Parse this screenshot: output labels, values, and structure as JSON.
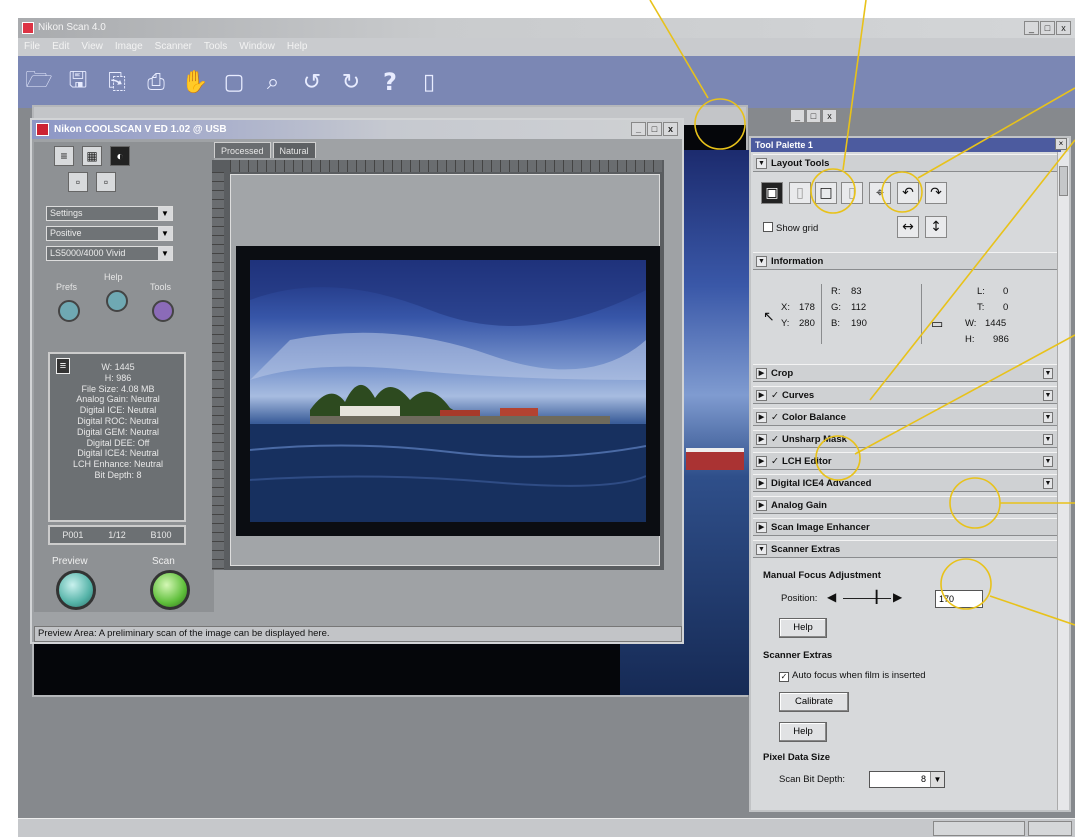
{
  "app": {
    "title": "Nikon Scan 4.0",
    "menu": [
      "File",
      "Edit",
      "View",
      "Image",
      "Scanner",
      "Tools",
      "Window",
      "Help"
    ],
    "window_buttons": [
      "_",
      "□",
      "x"
    ]
  },
  "toolbar": {
    "icons": [
      "open-folder-icon",
      "save-icon",
      "copy-icon",
      "print-icon",
      "hand-icon",
      "crop-icon",
      "zoom-icon",
      "rotate-left-icon",
      "rotate-right-icon",
      "help-icon",
      "info-icon"
    ],
    "help_glyph": "?"
  },
  "scanner_dialog": {
    "title": "Nikon COOLSCAN V ED 1.02 @ USB",
    "window_buttons": [
      "_",
      "□",
      "x"
    ],
    "dropdowns": [
      "Settings",
      "Positive",
      "LS5000/4000 Vivid"
    ],
    "round_buttons": {
      "prefs": "Prefs",
      "help": "Help",
      "tools": "Tools"
    },
    "info_lines": [
      "W: 1445",
      "H: 986",
      "File Size: 4.08 MB",
      "Analog Gain: Neutral",
      "Digital ICE: Neutral",
      "Digital ROC: Neutral",
      "Digital GEM: Neutral",
      "Digital DEE: Off",
      "Digital ICE4: Neutral",
      "LCH Enhance: Neutral",
      "Bit Depth: 8"
    ],
    "info_bar": [
      "P001",
      "1/12",
      "B100"
    ],
    "preview_label": "Preview",
    "scan_label": "Scan",
    "tabs": [
      "Processed",
      "Natural"
    ],
    "status_text": "Preview Area: A preliminary scan of the image can be displayed here."
  },
  "tool_palette": {
    "title": "Tool Palette 1",
    "layout_tools": {
      "header": "Layout Tools",
      "show_grid": "Show grid"
    },
    "information": {
      "header": "Information",
      "x_label": "X:",
      "x_value": "178",
      "y_label": "Y:",
      "y_value": "280",
      "r_label": "R:",
      "r_value": "83",
      "g_label": "G:",
      "g_value": "112",
      "b_label": "B:",
      "b_value": "190",
      "l_label": "L:",
      "l_value": "0",
      "t_label": "T:",
      "t_value": "0",
      "w_label": "W:",
      "w_value": "1445",
      "h_label": "H:",
      "h_value": "986"
    },
    "sections": [
      {
        "label": "Crop",
        "checked": false
      },
      {
        "label": "Curves",
        "checked": true
      },
      {
        "label": "Color Balance",
        "checked": true
      },
      {
        "label": "Unsharp Mask",
        "checked": true
      },
      {
        "label": "LCH Editor",
        "checked": true
      },
      {
        "label": "Digital ICE4 Advanced",
        "checked": false
      },
      {
        "label": "Analog Gain",
        "checked": false
      },
      {
        "label": "Scan Image Enhancer",
        "checked": false
      }
    ],
    "scanner_extras": {
      "header": "Scanner Extras",
      "manual_focus": "Manual Focus Adjustment",
      "position_label": "Position:",
      "position_value": "170",
      "help1": "Help",
      "extras_label": "Scanner Extras",
      "autofocus": "Auto focus when film is inserted",
      "calibrate": "Calibrate",
      "help2": "Help",
      "pixel_size": "Pixel Data Size",
      "bit_depth_label": "Scan Bit Depth:",
      "bit_depth_value": "8"
    }
  },
  "colors": {
    "callout": "#e8c21a",
    "toolbar": "#7b87b4",
    "palette_title": "#4c5b9f"
  }
}
